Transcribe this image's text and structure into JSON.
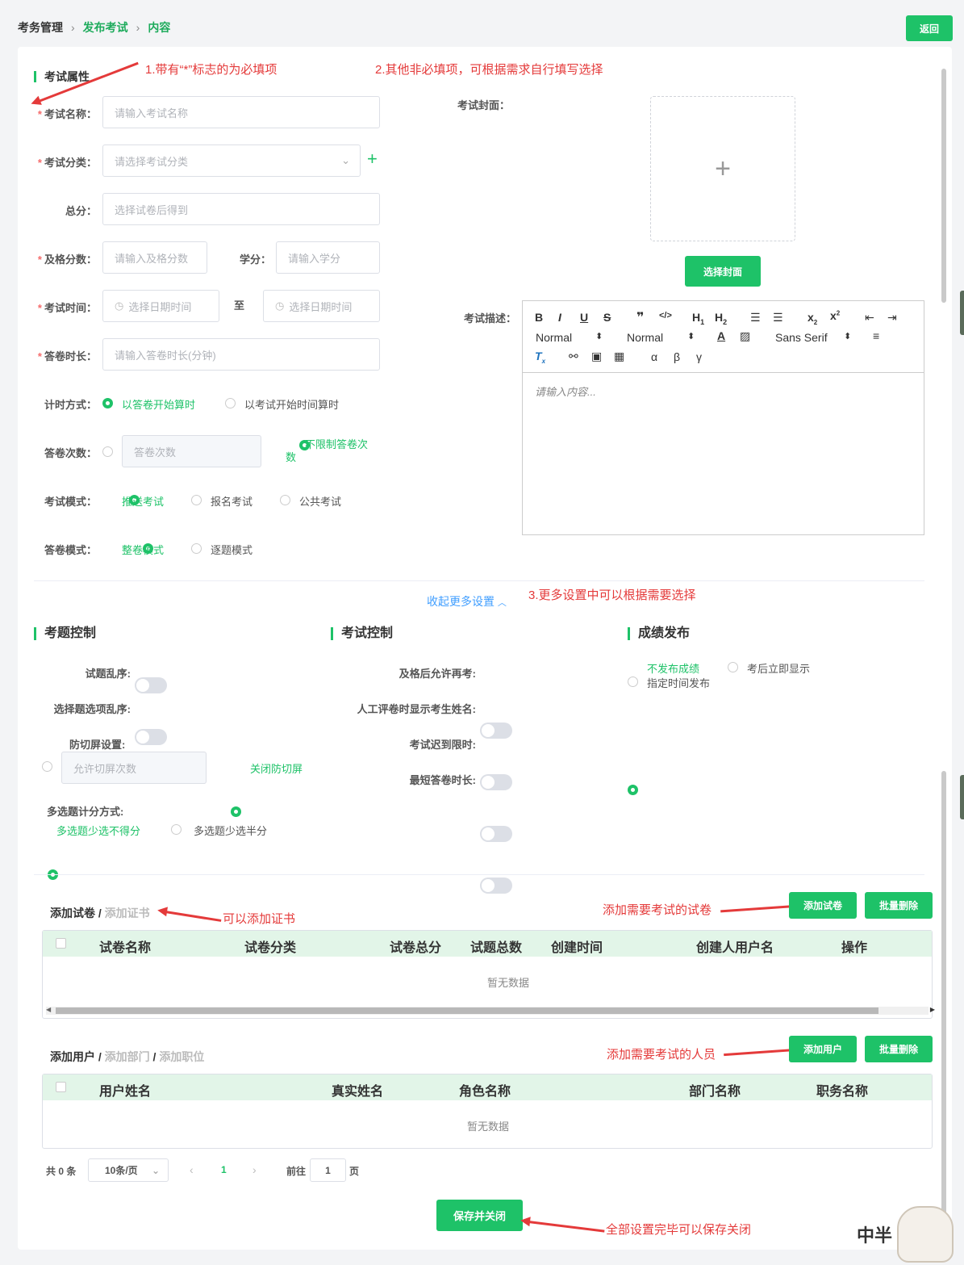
{
  "breadcrumb": {
    "root": "考务管理",
    "mid": "发布考试",
    "current": "内容"
  },
  "back_label": "返回",
  "sections": {
    "attrs": "考试属性",
    "question_control": "考题控制",
    "exam_control": "考试控制",
    "score_release": "成绩发布"
  },
  "notes": {
    "n1": "1.带有“*”标志的为必填项",
    "n2": "2.其他非必填项，可根据需求自行填写选择",
    "n3": "3.更多设置中可以根据需要选择",
    "cert": "可以添加证书",
    "paper": "添加需要考试的试卷",
    "user": "添加需要考试的人员",
    "save": "全部设置完毕可以保存关闭"
  },
  "form": {
    "req": "*",
    "name_label": "考试名称：",
    "name_ph": "请输入考试名称",
    "cat_label": "考试分类：",
    "cat_ph": "请选择考试分类",
    "total_label": "总分：",
    "total_ph": "选择试卷后得到",
    "pass_label": "及格分数：",
    "pass_ph": "请输入及格分数",
    "credit_label": "学分：",
    "credit_ph": "请输入学分",
    "time_label": "考试时间：",
    "time_ph": "选择日期时间",
    "to": "至",
    "dur_label": "答卷时长：",
    "dur_ph": "请输入答卷时长(分钟)",
    "timing_label": "计时方式：",
    "timing_opts": [
      "以答卷开始算时",
      "以考试开始时间算时"
    ],
    "attempts_label": "答卷次数：",
    "attempts_ph": "答卷次数",
    "unlimited_1": "不限制答卷次",
    "unlimited_2": "数",
    "mode_label": "考试模式：",
    "mode_opts": [
      "推送考试",
      "报名考试",
      "公共考试"
    ],
    "answer_label": "答卷模式：",
    "answer_opts": [
      "整卷模式",
      "逐题模式"
    ],
    "cover_label": "考试封面：",
    "cover_btn": "选择封面",
    "desc_label": "考试描述：",
    "desc_ph": "请输入内容..."
  },
  "editor": {
    "normal1": "Normal",
    "normal2": "Normal",
    "font": "Sans Serif",
    "alpha": "α",
    "beta": "β",
    "gamma": "γ"
  },
  "collapse": "收起更多设置",
  "qc": {
    "shuffle": "试题乱序:",
    "opt_shuffle": "选择题选项乱序:",
    "anti": "防切屏设置:",
    "anti_ph": "允许切屏次数",
    "anti_off": "关闭防切屏",
    "multi": "多选题计分方式:",
    "multi_opts": [
      "多选题少选不得分",
      "多选题少选半分"
    ]
  },
  "ec": {
    "retake": "及格后允许再考:",
    "show_name": "人工评卷时显示考生姓名:",
    "late": "考试迟到限时:",
    "min_time": "最短答卷时长:"
  },
  "sr": {
    "opts": [
      "不发布成绩",
      "考后立即显示",
      "指定时间发布"
    ]
  },
  "papers": {
    "tab_active": "添加试卷",
    "slash": " / ",
    "tab_cert": "添加证书",
    "add": "添加试卷",
    "del": "批量删除",
    "columns": [
      "试卷名称",
      "试卷分类",
      "试卷总分",
      "试题总数",
      "创建时间",
      "创建人用户名",
      "操作"
    ],
    "empty": "暂无数据"
  },
  "users": {
    "tab_active": "添加用户",
    "slash": " / ",
    "tab_dept": "添加部门",
    "tab_pos": "添加职位",
    "add": "添加用户",
    "del": "批量删除",
    "columns": [
      "用户姓名",
      "真实姓名",
      "角色名称",
      "部门名称",
      "职务名称"
    ],
    "empty": "暂无数据"
  },
  "pager": {
    "total": "共 0 条",
    "size": "10条/页",
    "page": "1",
    "goto": "前往",
    "goto_val": "1",
    "unit": "页"
  },
  "save": "保存并关闭",
  "watermark": "中半"
}
